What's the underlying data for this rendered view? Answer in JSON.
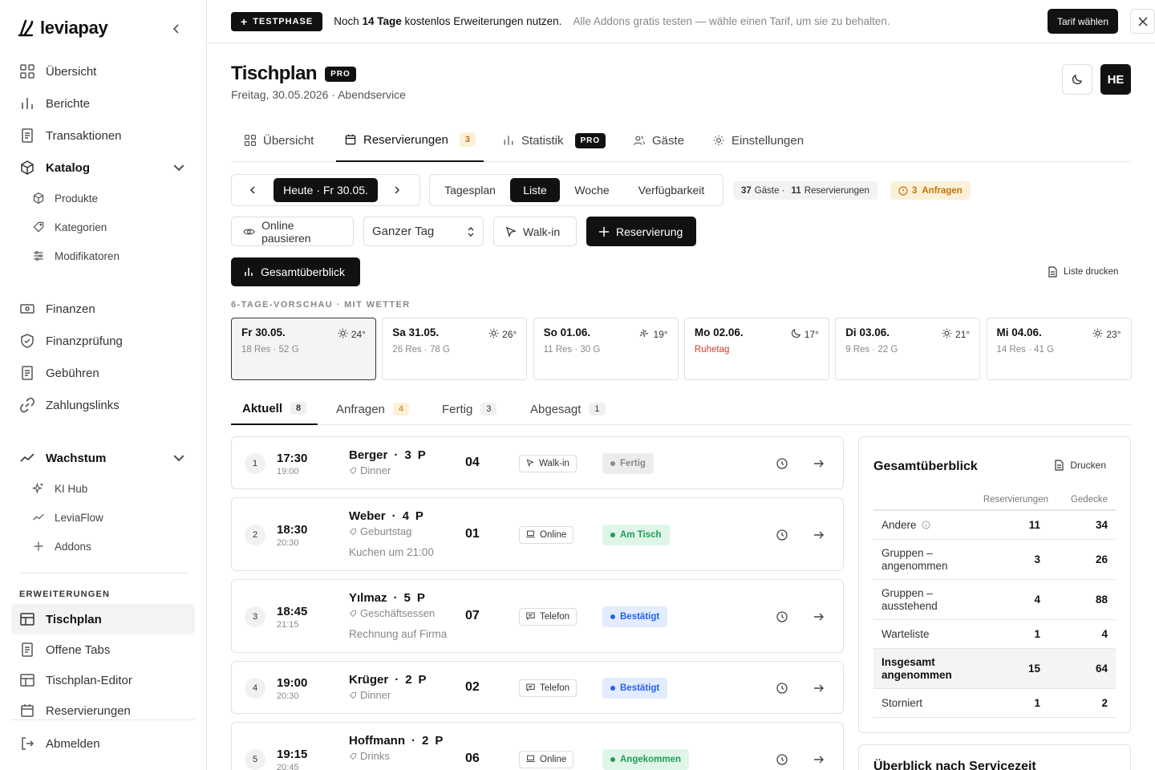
{
  "sidebar": {
    "brand": "leviapay",
    "items": [
      {
        "label": "Übersicht",
        "icon": "grid-icon"
      },
      {
        "label": "Berichte",
        "icon": "bar-chart-icon"
      },
      {
        "label": "Transaktionen",
        "icon": "receipt-icon"
      },
      {
        "label": "Katalog",
        "icon": "box-icon"
      },
      {
        "label": "Finanzen",
        "icon": "banknote-icon"
      },
      {
        "label": "Finanzprüfung",
        "icon": "shield-icon"
      },
      {
        "label": "Gebühren",
        "icon": "receipt-icon"
      },
      {
        "label": "Zahlungslinks",
        "icon": "link-icon"
      },
      {
        "label": "Wachstum",
        "icon": "trend-icon"
      }
    ],
    "katalog_sub": [
      "Produkte",
      "Kategorien",
      "Modifikatoren"
    ],
    "wachstum_sub": [
      "KI Hub",
      "LeviaFlow",
      "Addons"
    ],
    "ext_title": "ERWEITERUNGEN",
    "ext_items": [
      "Tischplan",
      "Offene Tabs",
      "Tischplan-Editor",
      "Reservierungen"
    ],
    "logout": "Abmelden"
  },
  "banner": {
    "badge": "TESTPHASE",
    "msg_pre": "Noch ",
    "msg_bold": "14 Tage",
    "msg_post": " kostenlos Erweiterungen nutzen.",
    "sub": "Alle Addons gratis testen — wähle einen Tarif, um sie zu behalten.",
    "cta": "Tarif wählen"
  },
  "header": {
    "title": "Tischplan",
    "badge": "PRO",
    "subtitle": "Freitag, 30.05.2026 · Abendservice",
    "avatar": "HE"
  },
  "tabs": [
    {
      "label": "Übersicht"
    },
    {
      "label": "Reservierungen",
      "count": "3"
    },
    {
      "label": "Statistik",
      "badge": "PRO"
    },
    {
      "label": "Gäste"
    },
    {
      "label": "Einstellungen"
    }
  ],
  "toolbar": {
    "date": "Heute · Fr 30.05.",
    "views": [
      "Tagesplan",
      "Liste",
      "Woche",
      "Verfügbarkeit"
    ],
    "stats_guests": "37",
    "stats_guests_label": "Gäste ·",
    "stats_res": "11",
    "stats_res_label": "Reservierungen",
    "requests": "3  Anfragen",
    "pause": "Online pausieren",
    "period": "Ganzer Tag",
    "walkin": "Walk-in",
    "new_res": "Reservierung",
    "overview_btn": "Gesamtüberblick",
    "print_list": "Liste drucken"
  },
  "forecast": {
    "label": "6-TAGE-VORSCHAU · MIT WETTER",
    "days": [
      {
        "day": "Fr 30.05.",
        "temp": "24°",
        "icon": "sun-icon",
        "detail": "18 Res · 52 G"
      },
      {
        "day": "Sa 31.05.",
        "temp": "26°",
        "icon": "sun-icon",
        "detail": "26 Res · 78 G"
      },
      {
        "day": "So 01.06.",
        "temp": "19°",
        "icon": "partly-sunny-icon",
        "detail": "11 Res · 30 G"
      },
      {
        "day": "Mo 02.06.",
        "temp": "17°",
        "icon": "moon-icon",
        "detail": "Ruhetag"
      },
      {
        "day": "Di 03.06.",
        "temp": "21°",
        "icon": "sun-icon",
        "detail": "9 Res · 22 G"
      },
      {
        "day": "Mi 04.06.",
        "temp": "23°",
        "icon": "sun-icon",
        "detail": "14 Res · 41 G"
      }
    ]
  },
  "subtabs": [
    {
      "label": "Aktuell",
      "count": "8"
    },
    {
      "label": "Anfragen",
      "count": "4"
    },
    {
      "label": "Fertig",
      "count": "3"
    },
    {
      "label": "Abgesagt",
      "count": "1"
    }
  ],
  "reservations": [
    {
      "n": "1",
      "time": "17:30",
      "end": "19:00",
      "name": "Berger",
      "party": "3",
      "unit": "P",
      "occasion": "Dinner",
      "note": "",
      "table": "04",
      "source": "Walk-in",
      "status": "Fertig"
    },
    {
      "n": "2",
      "time": "18:30",
      "end": "20:30",
      "name": "Weber",
      "party": "4",
      "unit": "P",
      "occasion": "Geburtstag",
      "note": "Kuchen um 21:00",
      "table": "01",
      "source": "Online",
      "status": "Am Tisch"
    },
    {
      "n": "3",
      "time": "18:45",
      "end": "21:15",
      "name": "Yılmaz",
      "party": "5",
      "unit": "P",
      "occasion": "Geschäftsessen",
      "note": "Rechnung auf Firma",
      "table": "07",
      "source": "Telefon",
      "status": "Bestätigt"
    },
    {
      "n": "4",
      "time": "19:00",
      "end": "20:30",
      "name": "Krüger",
      "party": "2",
      "unit": "P",
      "occasion": "Dinner",
      "note": "",
      "table": "02",
      "source": "Telefon",
      "status": "Bestätigt"
    },
    {
      "n": "5",
      "time": "19:15",
      "end": "20:45",
      "name": "Hoffmann",
      "party": "2",
      "unit": "P",
      "occasion": "Drinks",
      "note": "",
      "table": "06",
      "source": "Online",
      "status": "Angekommen"
    }
  ],
  "status_colors": {
    "Fertig": "#8a8a8a",
    "Am Tisch": "#1f9d55",
    "Bestätigt": "#2563eb",
    "Angekommen": "#1f9d55"
  },
  "overview": {
    "title": "Gesamtüberblick",
    "print": "Drucken",
    "col_res": "Reservierungen",
    "col_covers": "Gedecke",
    "rows": [
      {
        "label": "Andere",
        "res": "11",
        "covers": "34"
      },
      {
        "label": "Gruppen – angenommen",
        "res": "3",
        "covers": "26"
      },
      {
        "label": "Gruppen – ausstehend",
        "res": "4",
        "covers": "88"
      },
      {
        "label": "Warteliste",
        "res": "1",
        "covers": "4"
      },
      {
        "label": "Insgesamt angenommen",
        "res": "15",
        "covers": "64"
      },
      {
        "label": "Storniert",
        "res": "1",
        "covers": "2"
      }
    ]
  },
  "service_panel": {
    "title": "Überblick nach Servicezeit"
  }
}
